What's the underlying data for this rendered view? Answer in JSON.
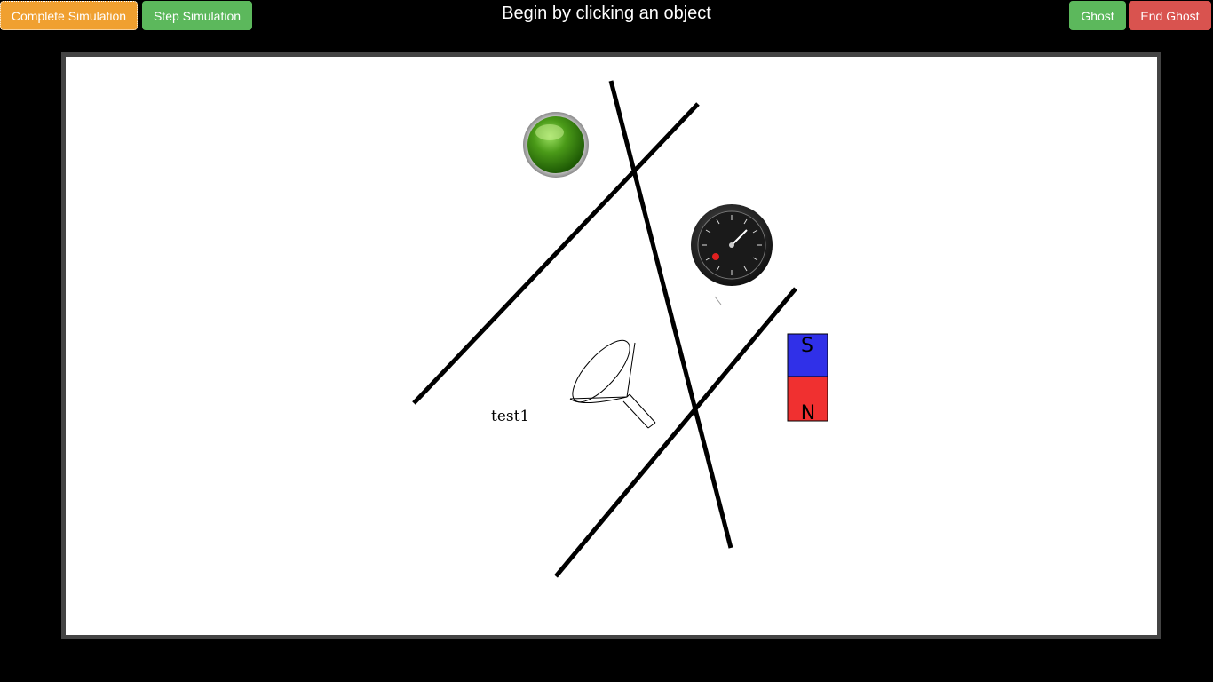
{
  "toolbar": {
    "complete_label": "Complete Simulation",
    "step_label": "Step Simulation",
    "ghost_label": "Ghost",
    "end_ghost_label": "End Ghost"
  },
  "status": {
    "message": "Begin by clicking an object"
  },
  "canvas": {
    "text_label": "test1",
    "magnet": {
      "south_label": "S",
      "north_label": "N"
    }
  },
  "colors": {
    "orange": "#f0a030",
    "green": "#5cb85c",
    "red": "#d9534f",
    "magnet_blue": "#3030e8",
    "magnet_red": "#f03030",
    "ball_green": "#3a8a10"
  },
  "icons": {
    "ball": "green-ball-icon",
    "gauge": "pressure-gauge-icon",
    "funnel": "funnel-icon",
    "magnet": "bar-magnet-icon"
  }
}
